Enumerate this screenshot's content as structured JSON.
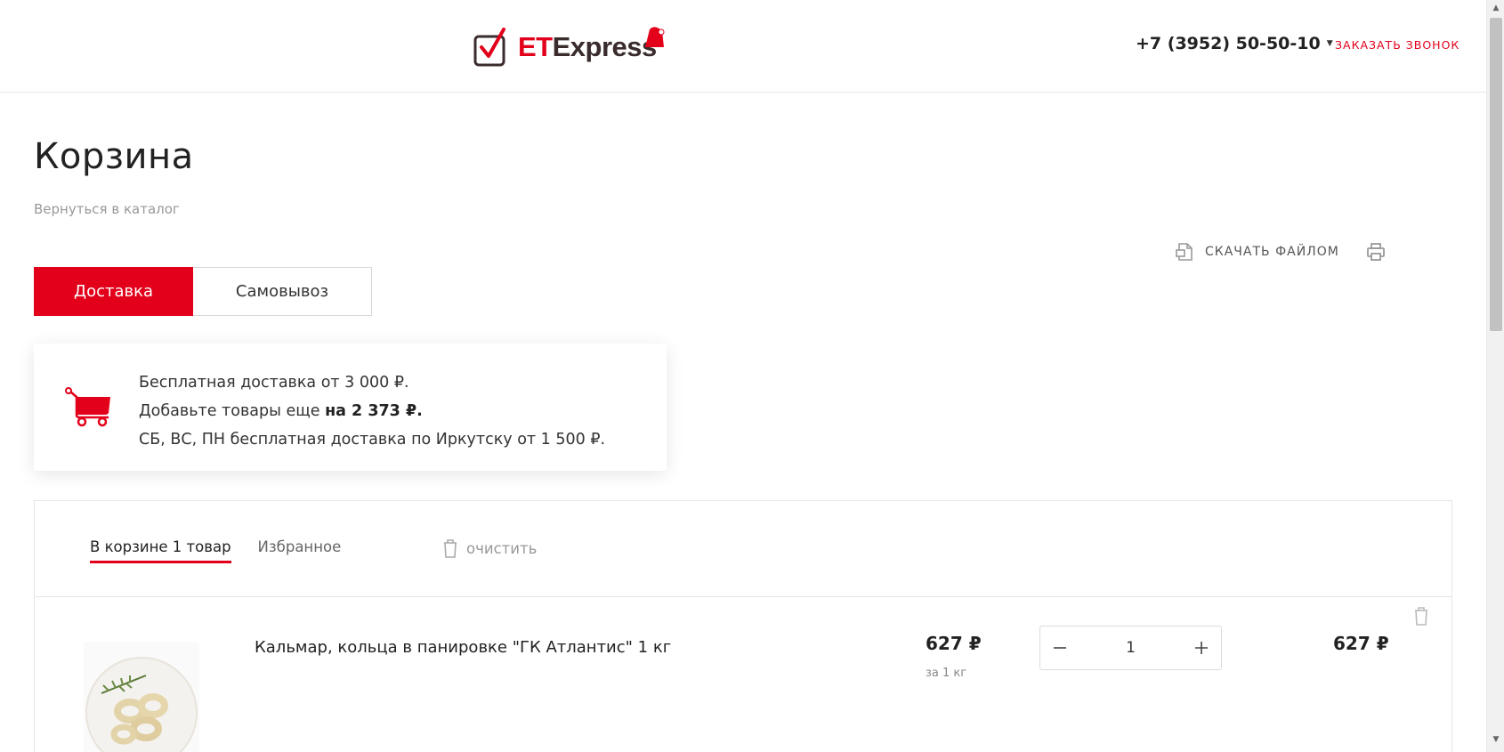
{
  "header": {
    "logo_text_et": "ET",
    "logo_text_express": "Express",
    "phone": "+7 (3952) 50-50-10",
    "callback_label": "ЗАКАЗАТЬ ЗВОНОК"
  },
  "page": {
    "title": "Корзина",
    "back_link": "Вернуться в каталог"
  },
  "actions": {
    "download_label": "СКАЧАТЬ ФАЙЛОМ"
  },
  "delivery_tabs": [
    {
      "label": "Доставка",
      "active": true
    },
    {
      "label": "Самовывоз",
      "active": false
    }
  ],
  "info": {
    "line1": "Бесплатная доставка от 3 000 ₽.",
    "line2_prefix": "Добавьте товары еще ",
    "line2_bold": "на 2 373 ₽.",
    "line3": "СБ, ВС, ПН бесплатная доставка по Иркутску от 1 500 ₽."
  },
  "cart": {
    "tab_cart": "В корзине 1 товар",
    "tab_favorites": "Избранное",
    "clear_label": "очистить",
    "items": [
      {
        "name": "Кальмар, кольца в панировке \"ГК Атлантис\" 1 кг",
        "unit_price": "627 ₽",
        "unit_label": "за 1 кг",
        "quantity": "1",
        "total_price": "627 ₽"
      }
    ]
  },
  "colors": {
    "accent": "#e2001a",
    "text": "#333333",
    "muted": "#999999"
  }
}
